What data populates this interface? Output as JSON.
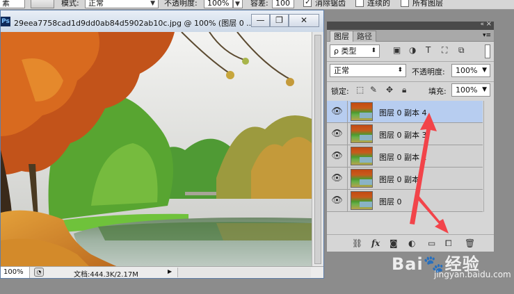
{
  "options_bar": {
    "tool_field": "素",
    "mode_label": "模式:",
    "mode_value": "正常",
    "opacity_label": "不透明度:",
    "opacity_value": "100%",
    "tolerance_label": "容差:",
    "tolerance_value": "100",
    "anti_alias_label": "消除锯齿",
    "anti_alias_checked": true,
    "contiguous_label": "连续的",
    "contiguous_checked": false,
    "all_layers_label": "所有图层",
    "all_layers_checked": false
  },
  "document": {
    "title": "29eea7758cad1d9dd0ab84d5902ab10c.jpg @ 100% (图层 0 ...",
    "app_icon": "Ps",
    "minimize_glyph": "—",
    "restore_glyph": "❐",
    "close_glyph": "✕",
    "status": {
      "zoom": "100%",
      "doc_info": "文档:444.3K/2.17M"
    }
  },
  "layers_panel": {
    "tabs": [
      {
        "label": "图层",
        "active": true
      },
      {
        "label": "路径",
        "active": false
      }
    ],
    "filter_kind": "ρ 类型",
    "blend_mode": "正常",
    "opacity_label": "不透明度:",
    "opacity_value": "100%",
    "lock_label": "锁定:",
    "fill_label": "填充:",
    "fill_value": "100%",
    "layers": [
      {
        "name": "图层 0 副本 4",
        "selected": true
      },
      {
        "name": "图层 0 副本 3",
        "selected": false
      },
      {
        "name": "图层 0 副本 2",
        "selected": false
      },
      {
        "name": "图层 0 副本",
        "selected": false
      },
      {
        "name": "图层 0",
        "selected": false
      }
    ],
    "footer_icons": [
      "link-icon",
      "fx-icon",
      "mask-icon",
      "adjustment-icon",
      "group-folder-icon",
      "new-layer-icon",
      "trash-icon"
    ],
    "fx_label": "fx"
  },
  "watermark": {
    "logo": "Bai🐾经验",
    "url": "jingyan.baidu.com"
  },
  "colors": {
    "annotation_arrow": "#f2444a",
    "selected_layer": "#b7cdf0",
    "workspace": "#8c8c8c"
  }
}
